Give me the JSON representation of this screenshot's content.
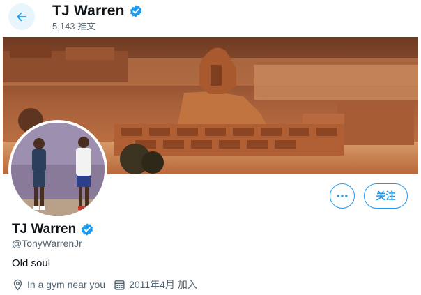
{
  "header": {
    "title": "TJ Warren",
    "tweet_count": "5,143 推文",
    "back_icon": "arrow-left-icon"
  },
  "profile": {
    "name": "TJ Warren",
    "handle": "@TonyWarrenJr",
    "bio": "Old soul",
    "location": "In a gym near you",
    "joined": "2011年4月 加入",
    "follow_label": "关注",
    "more_icon": "more-horizontal-icon",
    "verified_icon": "verified-badge-icon",
    "location_icon": "location-pin-icon",
    "calendar_icon": "calendar-icon"
  },
  "colors": {
    "accent": "#1d9bf0",
    "text": "#0f1419",
    "muted": "#536471"
  }
}
